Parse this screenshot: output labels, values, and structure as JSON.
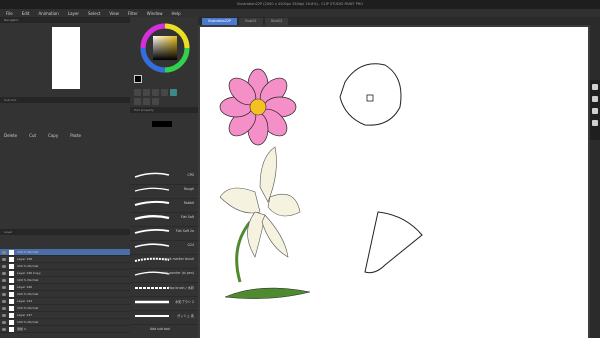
{
  "window": {
    "title": "Illustration22P (2000 x 4200px 350dpi 16.6%) - CLIP STUDIO PAINT PRO"
  },
  "menu": [
    "File",
    "Edit",
    "Animation",
    "Layer",
    "Select",
    "View",
    "Filter",
    "Window",
    "Help"
  ],
  "tabs": [
    {
      "label": "Illustration22P"
    },
    {
      "label": "Illust01"
    },
    {
      "label": "Illust02"
    }
  ],
  "panels": {
    "navigator": "Navigator",
    "sub_tool": "Sub tool",
    "tool_property": "Tool property",
    "layer": "Layer"
  },
  "edit_buttons": [
    "Delete",
    "Cut",
    "Copy",
    "Paste"
  ],
  "brushes": [
    {
      "name": "CPD"
    },
    {
      "name": "Rough"
    },
    {
      "name": "Rabbit"
    },
    {
      "name": "Flat Soft"
    },
    {
      "name": "Flat Soft 2a"
    },
    {
      "name": "G24"
    },
    {
      "name": "chalk marker brush"
    },
    {
      "name": "stick pointer (ai pen)"
    },
    {
      "name": "Hop brush / 水彩"
    },
    {
      "name": "水彩ブラシ 2"
    },
    {
      "name": "ガッシュ 素"
    }
  ],
  "brush_footer": "Add sub tool",
  "layers": [
    {
      "name": "100 % Normal",
      "selected": true
    },
    {
      "name": "Layer 148"
    },
    {
      "name": "100 % Normal"
    },
    {
      "name": "Layer 146 Copy"
    },
    {
      "name": "100 % Normal"
    },
    {
      "name": "Layer 146"
    },
    {
      "name": "100 % Normal"
    },
    {
      "name": "Layer 144"
    },
    {
      "name": "100 % Normal"
    },
    {
      "name": "Layer 147"
    },
    {
      "name": "100 % Normal"
    },
    {
      "name": "用紙 2"
    }
  ],
  "colors": {
    "accent": "#4a7bd0",
    "cosmos_petal": "#f48fc8",
    "cosmos_center": "#f5c021",
    "lily_petal": "#f6f2e0",
    "lily_leaf": "#4f8a2f"
  },
  "icons": [
    "camera-icon",
    "gear-icon",
    "layers-icon",
    "eye-icon"
  ]
}
